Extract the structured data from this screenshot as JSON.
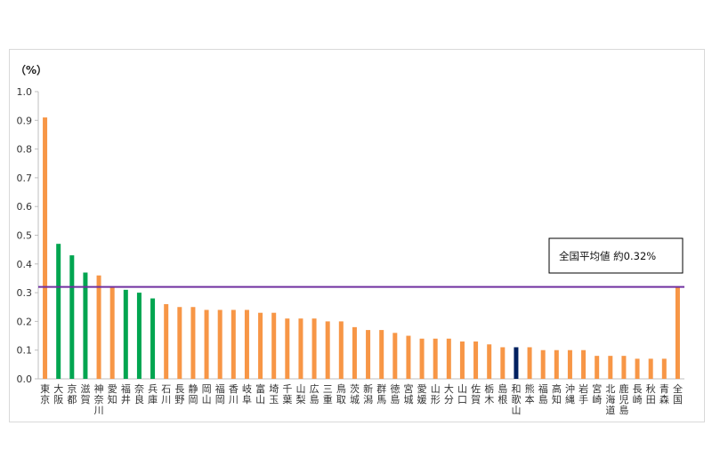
{
  "chart_data": {
    "type": "bar",
    "ylabel": "（%）",
    "ylim": [
      0,
      1.0
    ],
    "yticks": [
      "0.0",
      "0.1",
      "0.2",
      "0.3",
      "0.4",
      "0.5",
      "0.6",
      "0.7",
      "0.8",
      "0.9",
      "1.0"
    ],
    "categories": [
      "東京",
      "大阪",
      "京都",
      "滋賀",
      "神奈川",
      "愛知",
      "福井",
      "奈良",
      "兵庫",
      "石川",
      "長野",
      "静岡",
      "岡山",
      "福岡",
      "香川",
      "岐阜",
      "富山",
      "埼玉",
      "千葉",
      "山梨",
      "広島",
      "三重",
      "鳥取",
      "茨城",
      "新潟",
      "群馬",
      "徳島",
      "宮城",
      "愛媛",
      "山形",
      "大分",
      "山口",
      "佐賀",
      "栃木",
      "島根",
      "和歌山",
      "熊本",
      "福島",
      "高知",
      "沖縄",
      "岩手",
      "宮崎",
      "北海道",
      "鹿児島",
      "長崎",
      "秋田",
      "青森",
      "全国"
    ],
    "values": [
      0.91,
      0.47,
      0.43,
      0.37,
      0.36,
      0.32,
      0.31,
      0.3,
      0.28,
      0.26,
      0.25,
      0.25,
      0.24,
      0.24,
      0.24,
      0.24,
      0.23,
      0.23,
      0.21,
      0.21,
      0.21,
      0.2,
      0.2,
      0.18,
      0.17,
      0.17,
      0.16,
      0.15,
      0.14,
      0.14,
      0.14,
      0.13,
      0.13,
      0.12,
      0.11,
      0.11,
      0.11,
      0.1,
      0.1,
      0.1,
      0.1,
      0.08,
      0.08,
      0.08,
      0.07,
      0.07,
      0.07,
      0.32
    ],
    "bar_colors": [
      "#f79646",
      "#00a550",
      "#00a550",
      "#00a550",
      "#f79646",
      "#f79646",
      "#00a550",
      "#00a550",
      "#00a550",
      "#f79646",
      "#f79646",
      "#f79646",
      "#f79646",
      "#f79646",
      "#f79646",
      "#f79646",
      "#f79646",
      "#f79646",
      "#f79646",
      "#f79646",
      "#f79646",
      "#f79646",
      "#f79646",
      "#f79646",
      "#f79646",
      "#f79646",
      "#f79646",
      "#f79646",
      "#f79646",
      "#f79646",
      "#f79646",
      "#f79646",
      "#f79646",
      "#f79646",
      "#f79646",
      "#002060",
      "#f79646",
      "#f79646",
      "#f79646",
      "#f79646",
      "#f79646",
      "#f79646",
      "#f79646",
      "#f79646",
      "#f79646",
      "#f79646",
      "#f79646",
      "#f79646"
    ],
    "average_line": {
      "value": 0.32,
      "color": "#7030a0"
    },
    "annotation": "全国平均値  約0.32%",
    "axis_color": "#bfbfbf",
    "grid": false
  }
}
